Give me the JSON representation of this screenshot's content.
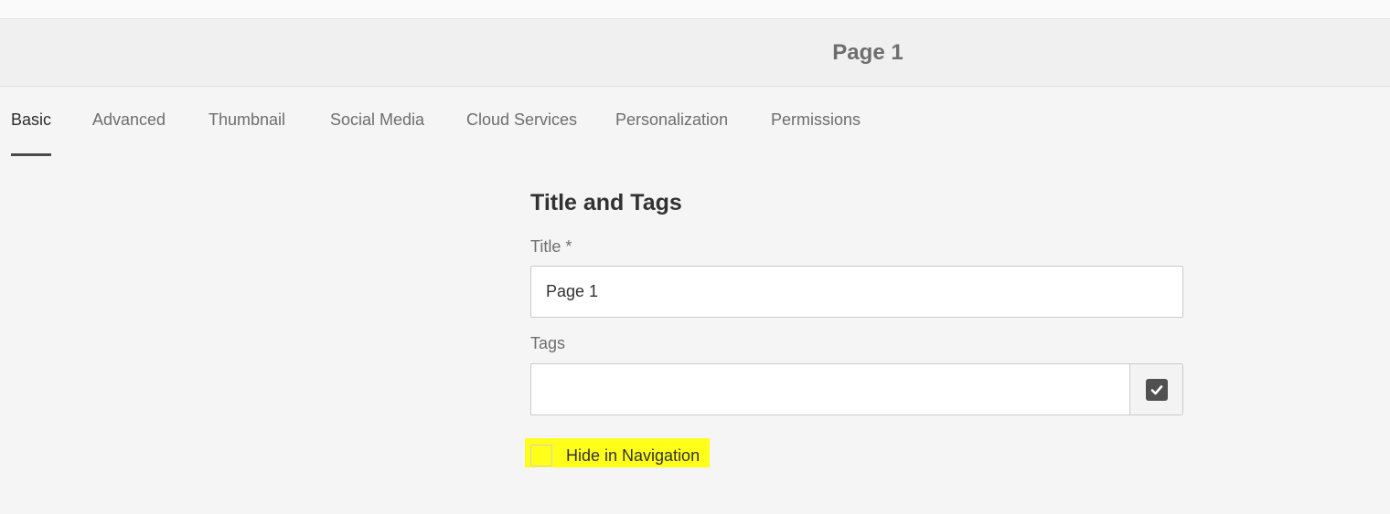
{
  "header": {
    "title": "Page 1"
  },
  "tabs": [
    {
      "label": "Basic",
      "active": true
    },
    {
      "label": "Advanced",
      "active": false
    },
    {
      "label": "Thumbnail",
      "active": false
    },
    {
      "label": "Social Media",
      "active": false
    },
    {
      "label": "Cloud Services",
      "active": false
    },
    {
      "label": "Personalization",
      "active": false
    },
    {
      "label": "Permissions",
      "active": false
    }
  ],
  "form": {
    "section_title": "Title and Tags",
    "title_field": {
      "label": "Title *",
      "value": "Page 1"
    },
    "tags_field": {
      "label": "Tags",
      "value": "",
      "picker_icon": "checkbox-checked-icon"
    },
    "hide_in_navigation": {
      "label": "Hide in Navigation",
      "checked": false,
      "highlight_color": "#ffff1a"
    }
  }
}
